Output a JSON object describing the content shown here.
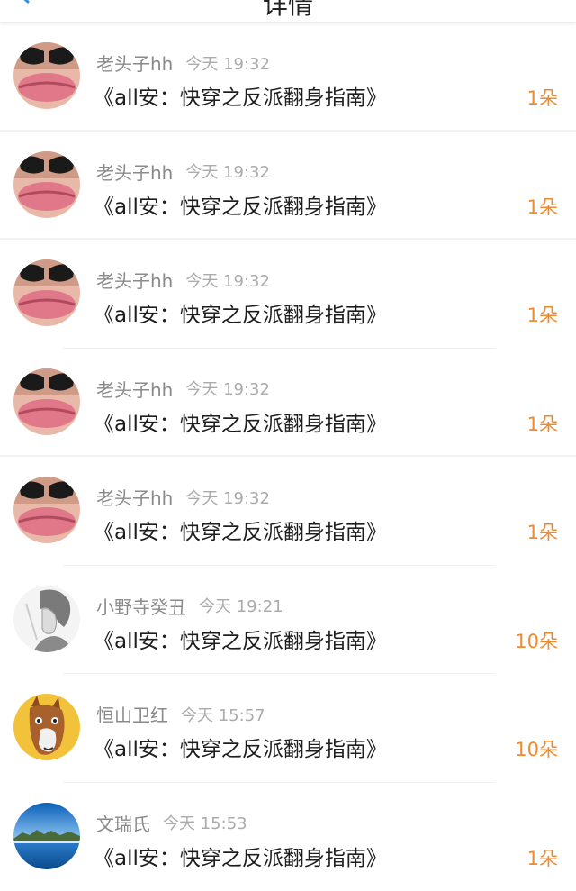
{
  "header": {
    "title": "详情"
  },
  "rows": [
    {
      "user": "老头子hh",
      "time": "今天 19:32",
      "title": "《all安：快穿之反派翻身指南》",
      "count": "1朵",
      "avatar": "lips-sunglasses-icon"
    },
    {
      "user": "老头子hh",
      "time": "今天 19:32",
      "title": "《all安：快穿之反派翻身指南》",
      "count": "1朵",
      "avatar": "lips-sunglasses-icon"
    },
    {
      "user": "老头子hh",
      "time": "今天 19:32",
      "title": "《all安：快穿之反派翻身指南》",
      "count": "1朵",
      "avatar": "lips-sunglasses-icon"
    },
    {
      "user": "老头子hh",
      "time": "今天 19:32",
      "title": "《all安：快穿之反派翻身指南》",
      "count": "1朵",
      "avatar": "lips-sunglasses-icon"
    },
    {
      "user": "老头子hh",
      "time": "今天 19:32",
      "title": "《all安：快穿之反派翻身指南》",
      "count": "1朵",
      "avatar": "lips-sunglasses-icon"
    },
    {
      "user": "小野寺癸丑",
      "time": "今天 19:21",
      "title": "《all安：快穿之反派翻身指南》",
      "count": "10朵",
      "avatar": "sketch-portrait-icon"
    },
    {
      "user": "恒山卫红",
      "time": "今天 15:57",
      "title": "《all安：快穿之反派翻身指南》",
      "count": "10朵",
      "avatar": "cartoon-horse-icon"
    },
    {
      "user": "文瑞氏",
      "time": "今天 15:53",
      "title": "《all安：快穿之反派翻身指南》",
      "count": "1朵",
      "avatar": "landscape-lake-icon"
    }
  ],
  "colors": {
    "accent": "#f08a2c",
    "username": "#8a8a8a",
    "timestamp": "#ababab",
    "title": "#1e1e1e"
  }
}
